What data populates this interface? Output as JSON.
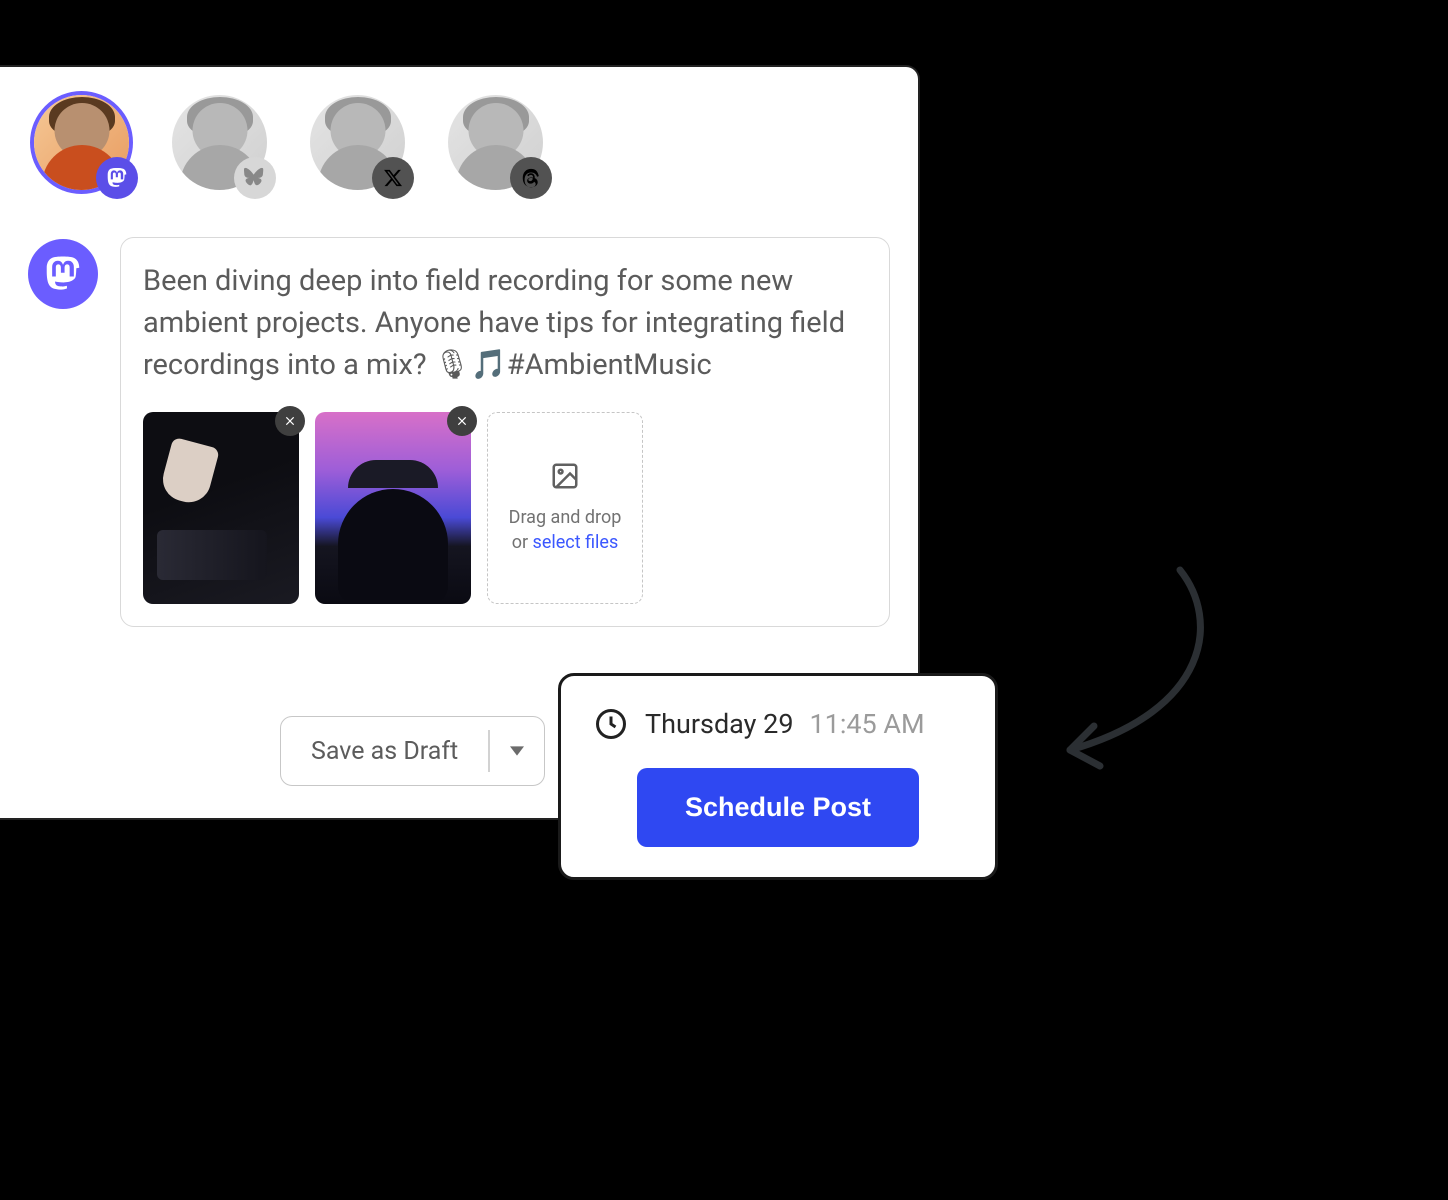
{
  "accounts": [
    {
      "platform": "mastodon",
      "platform_name": "mastodon-icon",
      "active": true
    },
    {
      "platform": "bluesky",
      "platform_name": "bluesky-icon",
      "active": false
    },
    {
      "platform": "x",
      "platform_name": "x-icon",
      "active": false
    },
    {
      "platform": "threads",
      "platform_name": "threads-icon",
      "active": false
    }
  ],
  "compose": {
    "platform": "mastodon",
    "text": "Been diving deep into field recording for some new ambient projects. Anyone have tips for integrating field recordings into a mix? 🎙🎵#AmbientMusic",
    "attachments": [
      {
        "name": "attachment-dj-mixer"
      },
      {
        "name": "attachment-headphones-person"
      }
    ],
    "dropzone": {
      "line1": "Drag and drop",
      "line2_prefix": "or ",
      "link": "select files"
    }
  },
  "draft_button": {
    "label": "Save as Draft"
  },
  "schedule": {
    "date": "Thursday 29",
    "time": "11:45 AM",
    "button": "Schedule Post"
  }
}
